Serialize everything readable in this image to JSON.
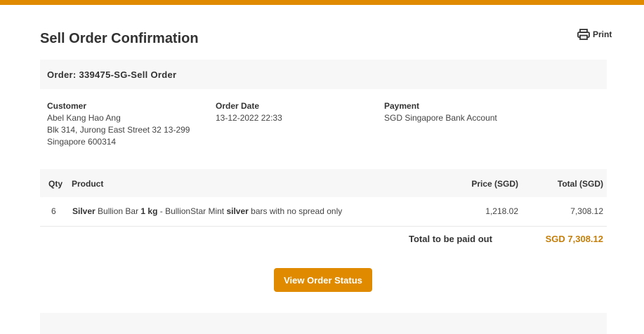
{
  "colors": {
    "accent": "#e08a00",
    "total_text": "#c47e0a",
    "panel_bg": "#f7f7f7"
  },
  "header": {
    "title": "Sell Order Confirmation",
    "print_label": "Print",
    "print_icon": "printer-icon"
  },
  "order": {
    "heading": "Order: 339475-SG-Sell Order"
  },
  "customer": {
    "label": "Customer",
    "name": "Abel Kang Hao Ang",
    "address1": "Blk 314, Jurong East Street 32 13-299",
    "address2": "Singapore 600314"
  },
  "order_date": {
    "label": "Order Date",
    "value": "13-12-2022 22:33"
  },
  "payment": {
    "label": "Payment",
    "value": "SGD Singapore Bank Account"
  },
  "table": {
    "headers": {
      "qty": "Qty",
      "product": "Product",
      "price": "Price (SGD)",
      "total": "Total (SGD)"
    },
    "rows": [
      {
        "qty": "6",
        "product_parts": [
          "Silver",
          " Bullion Bar ",
          "1 kg",
          " - BullionStar Mint ",
          "silver",
          " bars with no spread only"
        ],
        "price": "1,218.02",
        "total": "7,308.12"
      }
    ]
  },
  "summary": {
    "label": "Total to be paid out",
    "value": "SGD 7,308.12"
  },
  "actions": {
    "view_status": "View Order Status"
  }
}
